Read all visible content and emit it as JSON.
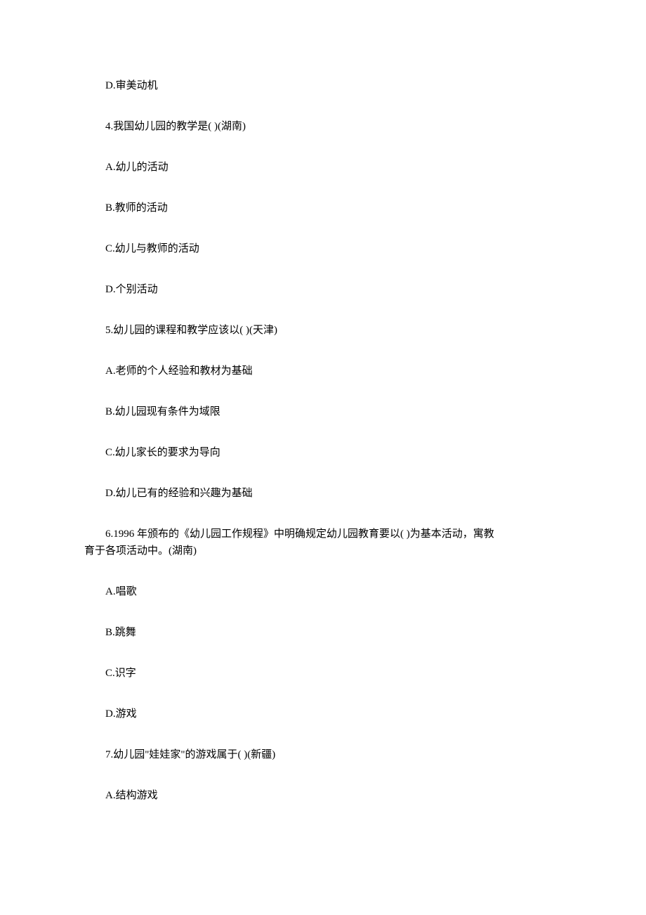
{
  "lines": {
    "l1": "D.审美动机",
    "l2": "4.我国幼儿园的教学是( )(湖南)",
    "l3": "A.幼儿的活动",
    "l4": "B.教师的活动",
    "l5": "C.幼儿与教师的活动",
    "l6": "D.个别活动",
    "l7": "5.幼儿园的课程和教学应该以( )(天津)",
    "l8": "A.老师的个人经验和教材为基础",
    "l9": "B.幼儿园现有条件为域限",
    "l10": "C.幼儿家长的要求为导向",
    "l11": "D.幼儿已有的经验和兴趣为基础",
    "l12a": "6.1996 年颁布的《幼儿园工作规程》中明确规定幼儿园教育要以( )为基本活动，寓教",
    "l12b": "育于各项活动中。(湖南)",
    "l13": "A.唱歌",
    "l14": "B.跳舞",
    "l15": "C.识字",
    "l16": "D.游戏",
    "l17": "7.幼儿园\"娃娃家\"的游戏属于( )(新疆)",
    "l18": "A.结构游戏"
  }
}
